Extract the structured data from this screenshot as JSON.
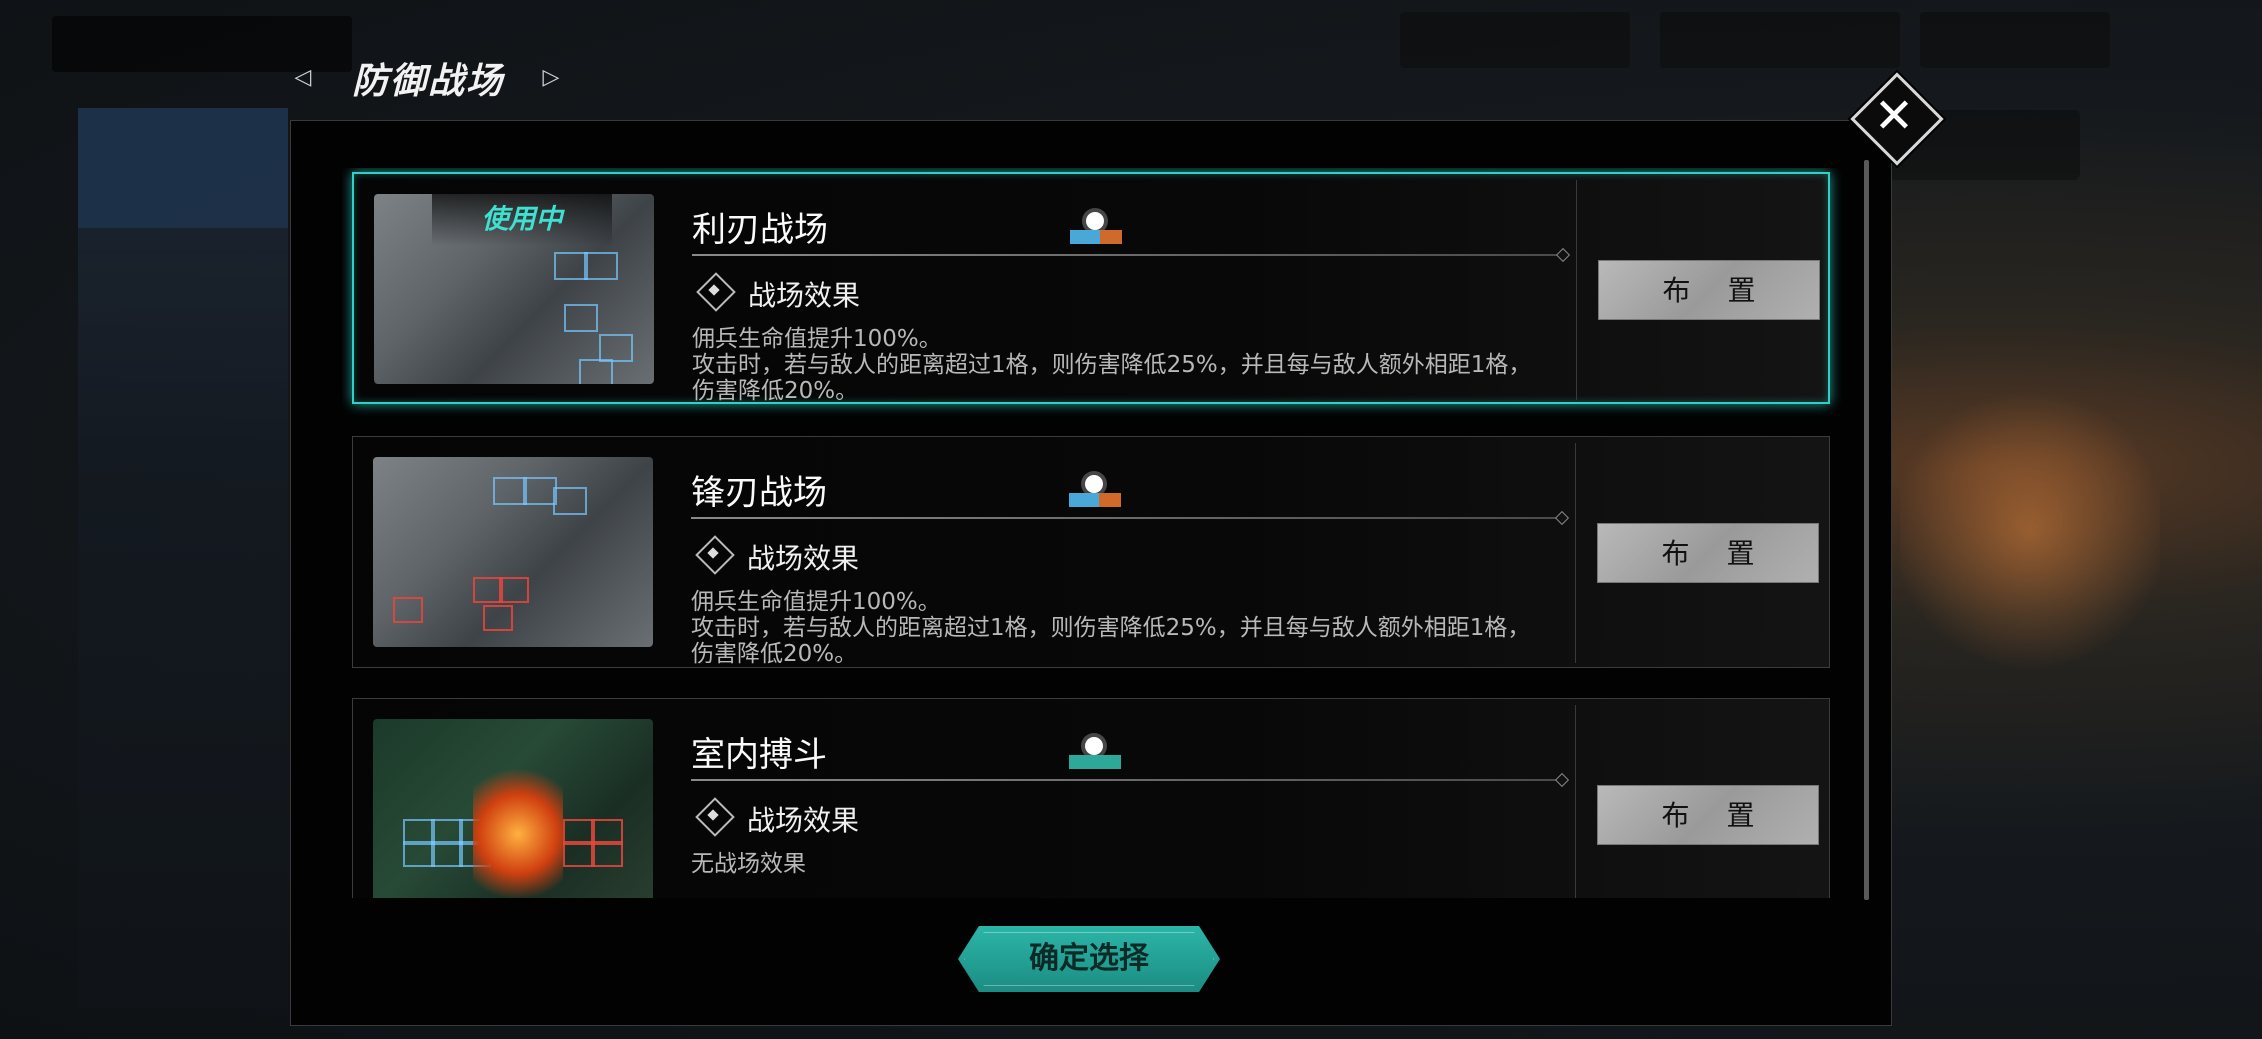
{
  "header": {
    "title": "防御战场",
    "prev_icon": "triangle-left-icon",
    "next_icon": "triangle-right-icon"
  },
  "dialog": {
    "close_icon": "close-x-icon",
    "confirm_label": "确定选择",
    "accent_color": "#2fd1c6"
  },
  "battlefields": [
    {
      "name": "利刃战场",
      "in_use_label": "使用中",
      "weather_icon": "sunny-weather-icon",
      "effect_label": "战场效果",
      "desc_lines": [
        "佣兵生命值提升100%。",
        "攻击时，若与敌人的距离超过1格，则伤害降低25%，并且每与敌人额外相距1格，",
        "伤害降低20%。"
      ],
      "button_label": "布 置",
      "selected": true
    },
    {
      "name": "锋刃战场",
      "weather_icon": "sunny-weather-icon",
      "effect_label": "战场效果",
      "desc_lines": [
        "佣兵生命值提升100%。",
        "攻击时，若与敌人的距离超过1格，则伤害降低25%，并且每与敌人额外相距1格，",
        "伤害降低20%。"
      ],
      "button_label": "布 置",
      "selected": false
    },
    {
      "name": "室内搏斗",
      "weather_icon": "sunny-weather-icon",
      "effect_label": "战场效果",
      "desc_lines": [
        "无战场效果"
      ],
      "button_label": "布 置",
      "selected": false
    }
  ]
}
